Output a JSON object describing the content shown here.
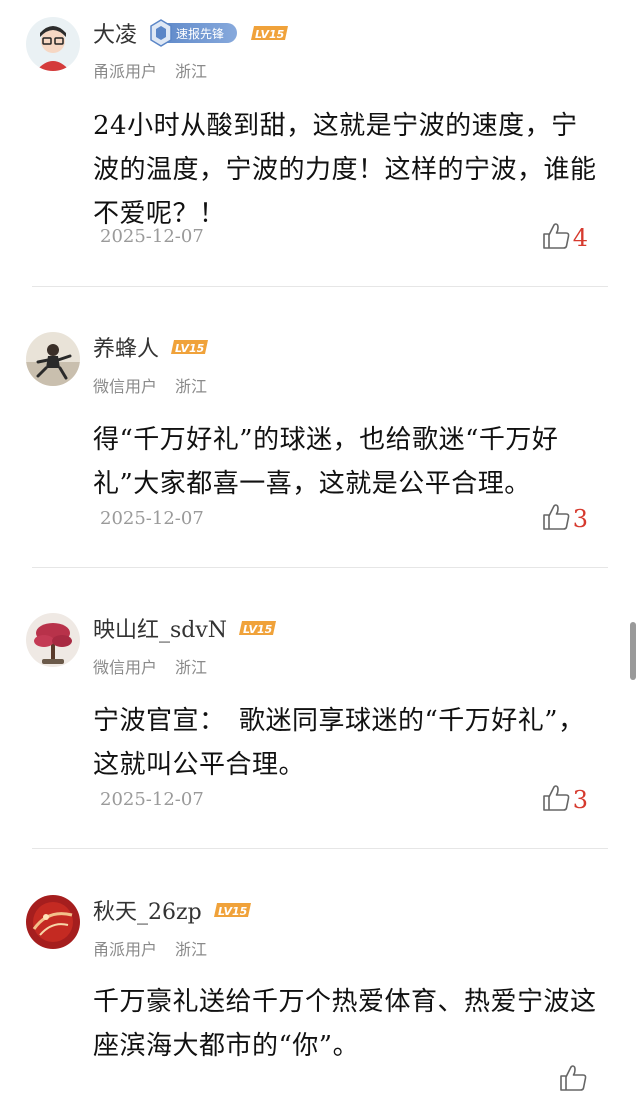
{
  "comments": [
    {
      "username": "大凌",
      "badge": "速报先锋",
      "level": "LV15",
      "source": "甬派用户",
      "region": "浙江",
      "content": "24小时从酸到甜，这就是宁波的速度，宁波的温度，宁波的力度！这样的宁波，谁能不爱呢？！",
      "date": "2025-12-07",
      "likes": "4"
    },
    {
      "username": "养蜂人",
      "level": "LV15",
      "source": "微信用户",
      "region": "浙江",
      "content": "得“千万好礼”的球迷，也给歌迷“千万好礼”大家都喜一喜，这就是公平合理。",
      "date": "2025-12-07",
      "likes": "3"
    },
    {
      "username": "映山红_sdvN",
      "level": "LV15",
      "source": "微信用户",
      "region": "浙江",
      "content": "宁波官宣：　歌迷同享球迷的“千万好礼”，这就叫公平合理。",
      "date": "2025-12-07",
      "likes": "3"
    },
    {
      "username": "秋天_26zp",
      "level": "LV15",
      "source": "甬派用户",
      "region": "浙江",
      "content": "千万豪礼送给千万个热爱体育、热爱宁波这座滨海大都市的“你”。"
    }
  ],
  "colors": {
    "like_count": "#d63a2e",
    "level_badge": "#f0a23a",
    "divider": "#e6e6e6"
  }
}
